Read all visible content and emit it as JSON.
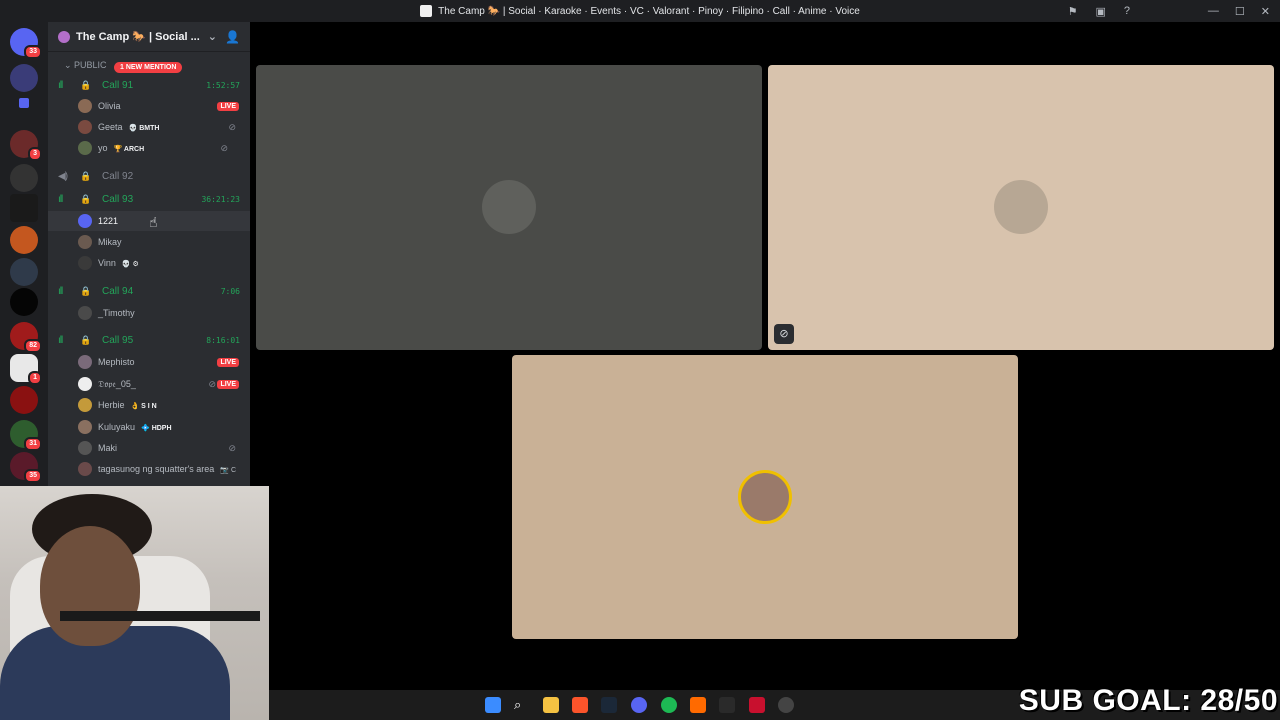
{
  "window": {
    "title": "The Camp 🐎 | Social · Karaoke · Events · VC · Valorant · Pinoy · Filipino · Call · Anime · Voice"
  },
  "server_rail": {
    "home_badge": "33",
    "badges": [
      "3",
      "82",
      "1",
      "31",
      "35"
    ]
  },
  "guild": {
    "name": "The Camp 🐎 | Social ...",
    "category": "PUBLIC",
    "mention_label": "1 NEW MENTION"
  },
  "voice_channels": [
    {
      "name": "Call 91",
      "timer": "1:52:57",
      "members": [
        {
          "name": "Olivia",
          "tag": "",
          "live": true
        },
        {
          "name": "Geeta",
          "tag": "💀 BMTH",
          "live": false
        },
        {
          "name": "yo",
          "tag": "🏆 ARCH",
          "live": false
        }
      ]
    },
    {
      "name": "Call 92",
      "timer": "",
      "members": []
    },
    {
      "name": "Call 93",
      "timer": "36:21:23",
      "members": [
        {
          "name": "1221",
          "tag": "",
          "live": false
        },
        {
          "name": "Mikay",
          "tag": "",
          "live": false
        },
        {
          "name": "Vinn",
          "tag": "💀 ⚙",
          "live": false
        }
      ]
    },
    {
      "name": "Call 94",
      "timer": "7:06",
      "members": [
        {
          "name": "_Timothy",
          "tag": "",
          "live": false
        }
      ]
    },
    {
      "name": "Call 95",
      "timer": "8:16:01",
      "members": [
        {
          "name": "Mephisto",
          "tag": "",
          "live": true
        },
        {
          "name": "𝔇𝔬𝔭𝔢_05_",
          "tag": "",
          "live": true
        },
        {
          "name": "Herbie",
          "tag": "👌 S I N",
          "live": false
        },
        {
          "name": "Kuluyaku",
          "tag": "💠 HDPH",
          "live": false
        },
        {
          "name": "Maki",
          "tag": "",
          "live": false
        },
        {
          "name": "tagasunog ng squatter's area",
          "tag": "📷 C",
          "live": false
        }
      ]
    }
  ],
  "labels": {
    "live": "LIVE"
  },
  "overlay": {
    "sub_goal": "SUB GOAL: 28/50"
  },
  "colors": {
    "online_green": "#23a55a",
    "live_red": "#f23f43",
    "tile_grey": "#4a4b48",
    "tile_beige_1": "#d8c3ad",
    "tile_beige_2": "#c9b196"
  }
}
